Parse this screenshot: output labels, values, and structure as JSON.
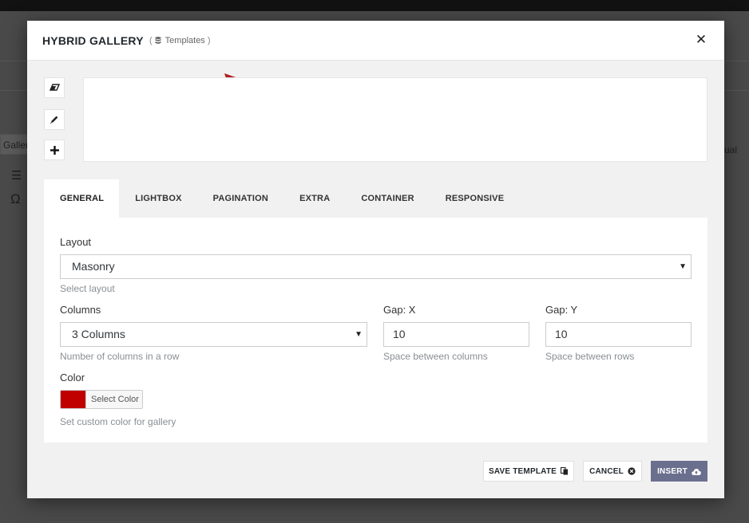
{
  "background": {
    "left_tab": "Gallery",
    "right_text": "ual"
  },
  "modal": {
    "title": "HYBRID GALLERY",
    "templates_open_paren": "(",
    "templates_label": "Templates",
    "templates_close_paren": ")",
    "close_glyph": "✕"
  },
  "tools": [
    {
      "name": "eraser-icon"
    },
    {
      "name": "pencil-icon"
    },
    {
      "name": "plus-icon"
    }
  ],
  "tabs": [
    {
      "label": "GENERAL",
      "active": true
    },
    {
      "label": "LIGHTBOX",
      "active": false
    },
    {
      "label": "PAGINATION",
      "active": false
    },
    {
      "label": "EXTRA",
      "active": false
    },
    {
      "label": "CONTAINER",
      "active": false
    },
    {
      "label": "RESPONSIVE",
      "active": false
    }
  ],
  "general": {
    "layout": {
      "label": "Layout",
      "value": "Masonry",
      "help": "Select layout"
    },
    "columns": {
      "label": "Columns",
      "value": "3 Columns",
      "help": "Number of columns in a row"
    },
    "gap_x": {
      "label": "Gap: X",
      "value": "10",
      "help": "Space between columns"
    },
    "gap_y": {
      "label": "Gap: Y",
      "value": "10",
      "help": "Space between rows"
    },
    "color": {
      "label": "Color",
      "button": "Select Color",
      "value": "#c00000",
      "help": "Set custom color for gallery"
    }
  },
  "footer": {
    "save_template": "SAVE TEMPLATE",
    "cancel": "CANCEL",
    "insert": "INSERT"
  },
  "colors": {
    "accent": "#6b6f8e",
    "arrow": "#b01c1c"
  }
}
